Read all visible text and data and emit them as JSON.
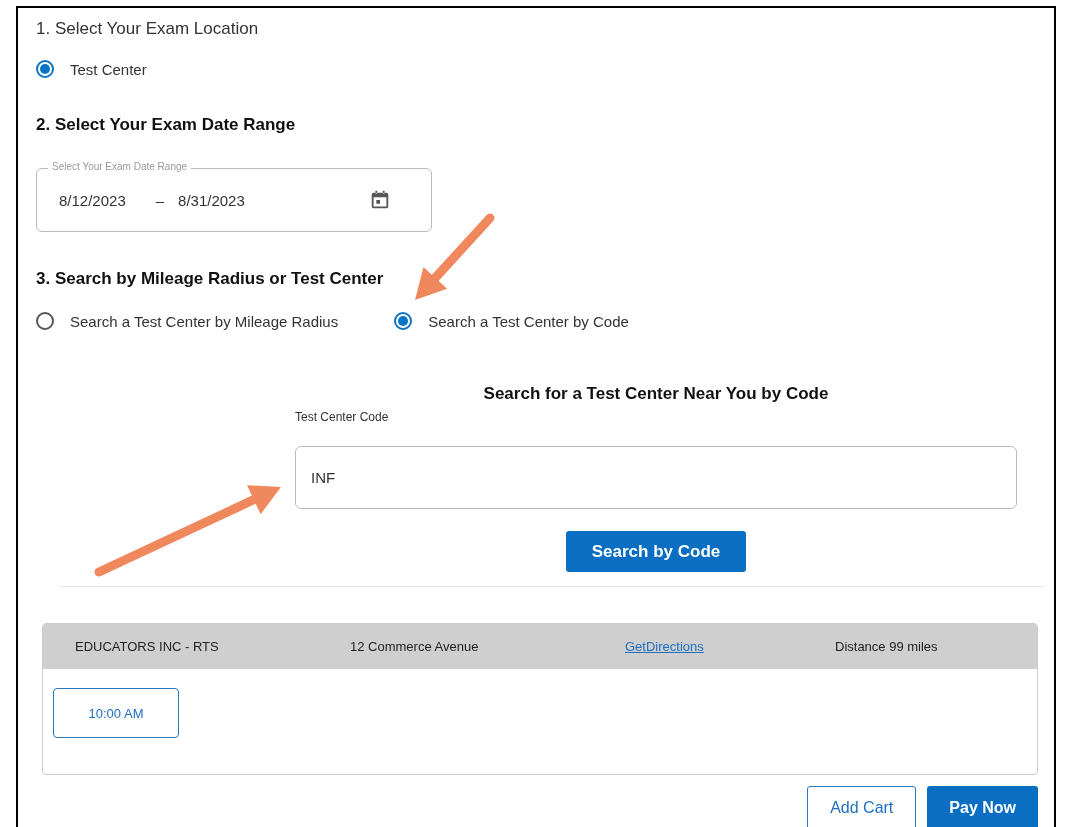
{
  "location": {
    "heading": "1. Select Your Exam Location",
    "options": [
      {
        "label": "Test Center",
        "selected": true
      }
    ]
  },
  "date_range": {
    "heading": "2. Select Your Exam Date Range",
    "label": "Select Your Exam Date Range",
    "start": "8/12/2023",
    "separator": "–",
    "end": "8/31/2023"
  },
  "search_mode": {
    "heading": "3. Search by Mileage Radius or Test Center",
    "options": [
      {
        "label": "Search a Test Center by Mileage Radius",
        "selected": false
      },
      {
        "label": "Search a Test Center by Code",
        "selected": true
      }
    ]
  },
  "code_search": {
    "heading": "Search for a Test Center Near You by Code",
    "field_label": "Test Center Code",
    "value": "INF",
    "button": "Search by Code"
  },
  "results": [
    {
      "name": "EDUCATORS INC - RTS",
      "address": "12 Commerce Avenue",
      "link": "GetDirections",
      "distance": "Distance 99 miles",
      "times": [
        "10:00 AM"
      ]
    }
  ],
  "actions": [
    {
      "label": "Add Cart",
      "kind": "outline"
    },
    {
      "label": "Pay Now",
      "kind": "primary"
    }
  ]
}
